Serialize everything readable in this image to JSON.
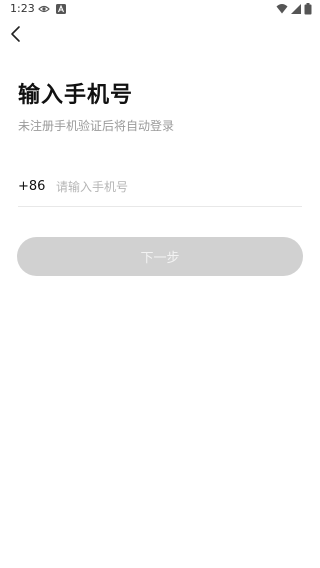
{
  "status_bar": {
    "time": "1:23",
    "icons": [
      "eye-icon",
      "a-badge-icon",
      "wifi-icon",
      "signal-icon",
      "battery-icon"
    ]
  },
  "header": {
    "back_icon": "chevron-left-icon"
  },
  "main": {
    "title": "输入手机号",
    "subtitle": "未注册手机验证后将自动登录",
    "country_code": "+86",
    "phone_input": {
      "value": "",
      "placeholder": "请输入手机号"
    },
    "next_button_label": "下一步"
  },
  "colors": {
    "title": "#111111",
    "subtitle": "#9a9a9a",
    "placeholder": "#b5b5b5",
    "button_bg_disabled": "#d1d1d1",
    "button_text_disabled": "#f3f3f3",
    "divider": "#e8e8e8"
  }
}
